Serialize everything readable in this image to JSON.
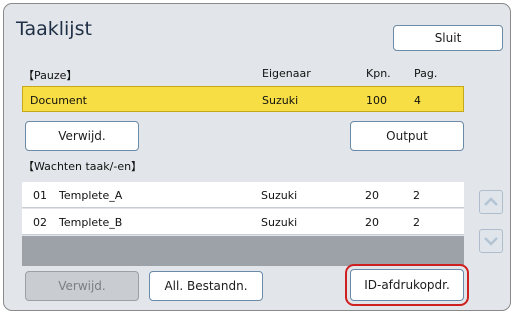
{
  "window": {
    "title": "Taaklijst"
  },
  "toolbar": {
    "close_label": "Sluit"
  },
  "paused": {
    "section_label": "【Pauze】",
    "columns": {
      "owner": "Eigenaar",
      "copies": "Kpn.",
      "pages": "Pag."
    },
    "job": {
      "name": "Document",
      "owner": "Suzuki",
      "copies": "100",
      "pages": "4"
    },
    "delete_label": "Verwijd.",
    "output_label": "Output"
  },
  "waiting": {
    "section_label": "【Wachten taak/-en】",
    "jobs": [
      {
        "index": "01",
        "name": "Templete_A",
        "owner": "Suzuki",
        "copies": "20",
        "pages": "2"
      },
      {
        "index": "02",
        "name": "Templete_B",
        "owner": "Suzuki",
        "copies": "20",
        "pages": "2"
      }
    ],
    "delete_label": "Verwijd.",
    "all_files_label": "All. Bestandn.",
    "id_print_label": "ID-afdrukopdr."
  },
  "icons": {
    "scroll_up": "chevron-up-icon",
    "scroll_down": "chevron-down-icon"
  },
  "colors": {
    "selected_row": "#f7de44",
    "highlight": "#cf2020",
    "accent": "#6a8aa8"
  }
}
